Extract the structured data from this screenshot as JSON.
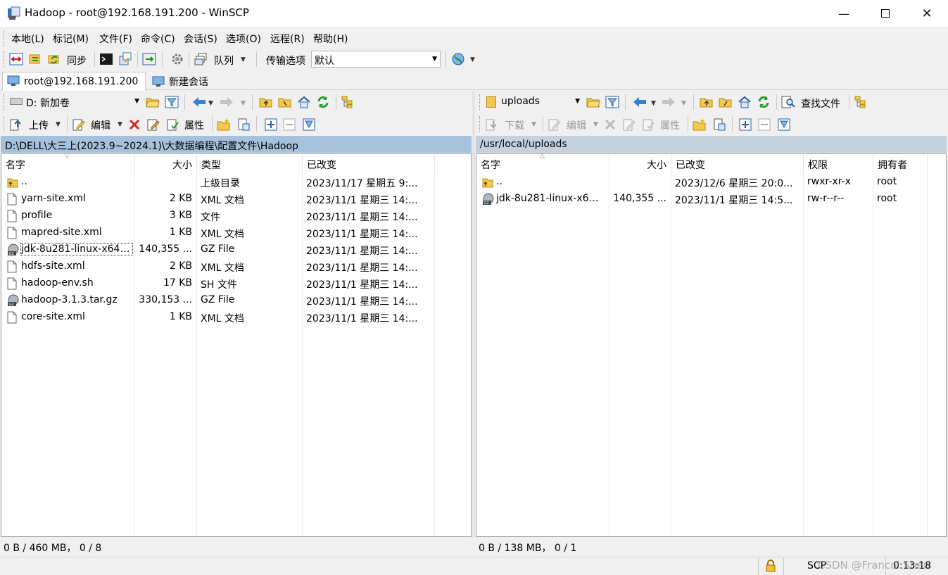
{
  "window": {
    "title": "Hadoop - root@192.168.191.200 - WinSCP",
    "minimize_icon": "minimize-icon",
    "maximize_icon": "maximize-icon",
    "close_icon": "close-icon"
  },
  "menu": [
    "本地(L)",
    "标记(M)",
    "文件(F)",
    "命令(C)",
    "会话(S)",
    "选项(O)",
    "远程(R)",
    "帮助(H)"
  ],
  "toolbar": {
    "sync_label": "同步",
    "queue_label": "队列",
    "transfer_options_label": "传输选项",
    "transfer_preset": "默认"
  },
  "tabs": {
    "session": "root@192.168.191.200",
    "new_session": "新建会话"
  },
  "left": {
    "drive": "D: 新加卷",
    "upload_label": "上传",
    "edit_label": "编辑",
    "properties_label": "属性",
    "path": "D:\\DELL\\大三上(2023.9~2024.1)\\大数据编程\\配置文件\\Hadoop",
    "columns": [
      "名字",
      "大小",
      "类型",
      "已改变"
    ],
    "rows": [
      {
        "name": "..",
        "size": "",
        "type": "上级目录",
        "changed": "2023/11/17 星期五  9:..."
      },
      {
        "name": "yarn-site.xml",
        "size": "2 KB",
        "type": "XML 文档",
        "changed": "2023/11/1 星期三  14:..."
      },
      {
        "name": "profile",
        "size": "3 KB",
        "type": "文件",
        "changed": "2023/11/1 星期三  14:..."
      },
      {
        "name": "mapred-site.xml",
        "size": "1 KB",
        "type": "XML 文档",
        "changed": "2023/11/1 星期三  14:..."
      },
      {
        "name": "jdk-8u281-linux-x64....",
        "size": "140,355 ...",
        "type": "GZ File",
        "changed": "2023/11/1 星期三  14:..."
      },
      {
        "name": "hdfs-site.xml",
        "size": "2 KB",
        "type": "XML 文档",
        "changed": "2023/11/1 星期三  14:..."
      },
      {
        "name": "hadoop-env.sh",
        "size": "17 KB",
        "type": "SH 文件",
        "changed": "2023/11/1 星期三  14:..."
      },
      {
        "name": "hadoop-3.1.3.tar.gz",
        "size": "330,153 ...",
        "type": "GZ File",
        "changed": "2023/11/1 星期三  14:..."
      },
      {
        "name": "core-site.xml",
        "size": "1 KB",
        "type": "XML 文档",
        "changed": "2023/11/1 星期三  14:..."
      }
    ],
    "status": "0 B / 460 MB，  0 / 8"
  },
  "right": {
    "folder": "uploads",
    "find_files_label": "查找文件",
    "download_label": "下载",
    "edit_label": "编辑",
    "properties_label": "属性",
    "path": "/usr/local/uploads",
    "columns": [
      "名字",
      "大小",
      "已改变",
      "权限",
      "拥有者"
    ],
    "rows": [
      {
        "name": "..",
        "size": "",
        "changed": "2023/12/6 星期三 20:0...",
        "rights": "rwxr-xr-x",
        "owner": "root"
      },
      {
        "name": "jdk-8u281-linux-x64....",
        "size": "140,355 ...",
        "changed": "2023/11/1 星期三 14:5...",
        "rights": "rw-r--r--",
        "owner": "root"
      }
    ],
    "status": "0 B / 138 MB，  0 / 1"
  },
  "bottom": {
    "protocol": "SCP",
    "time": "0:13:18",
    "watermark": "CSDN @Francol Shen",
    "lock_icon": "lock-icon"
  }
}
